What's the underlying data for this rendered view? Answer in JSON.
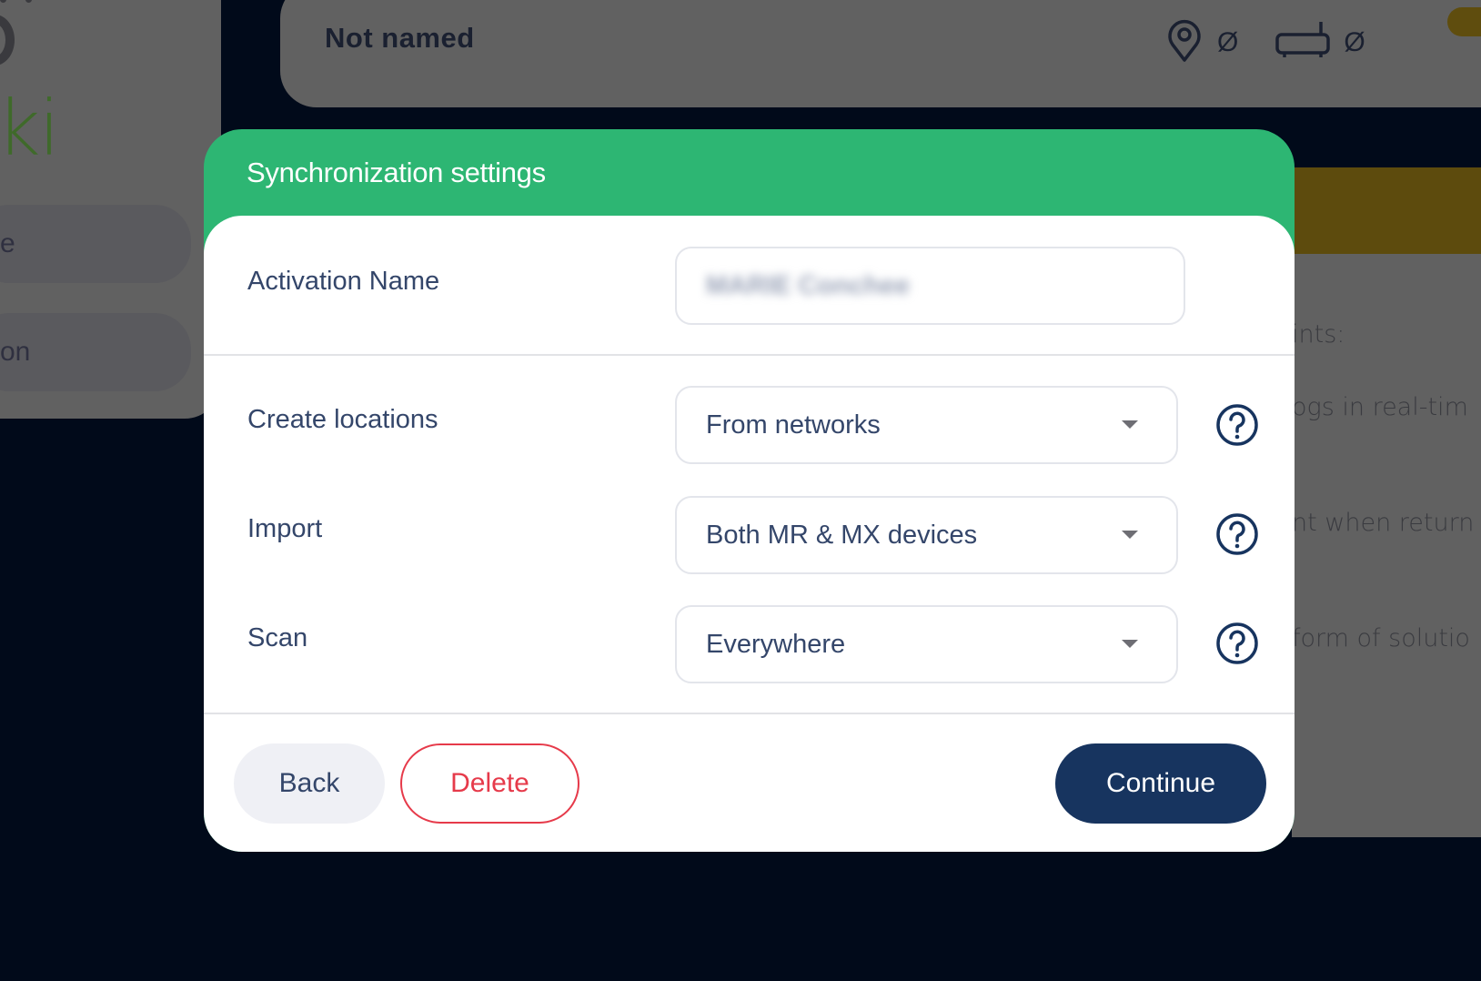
{
  "background": {
    "sidebar": {
      "logo_text_fragment": "ki",
      "items": [
        {
          "label_fragment": "e"
        },
        {
          "label_fragment": "on"
        }
      ]
    },
    "top_card": {
      "name": "Not named",
      "location_count": "Ø",
      "device_count": "Ø"
    },
    "right_panel": {
      "lines": [
        "ints:",
        "ogs in real-tim",
        "nt when return",
        "form of solutio"
      ]
    }
  },
  "modal": {
    "title": "Synchronization settings",
    "header_color": "#2db673",
    "fields": {
      "activation_name": {
        "label": "Activation Name",
        "value": "MARIE Conchee",
        "value_redacted": true
      },
      "create_locations": {
        "label": "Create locations",
        "selected": "From networks"
      },
      "import": {
        "label": "Import",
        "selected": "Both MR & MX devices"
      },
      "scan": {
        "label": "Scan",
        "selected": "Everywhere"
      }
    },
    "buttons": {
      "back": "Back",
      "delete": "Delete",
      "continue": "Continue"
    },
    "colors": {
      "primary": "#17345f",
      "danger": "#e63a4a",
      "text": "#34466a"
    }
  }
}
